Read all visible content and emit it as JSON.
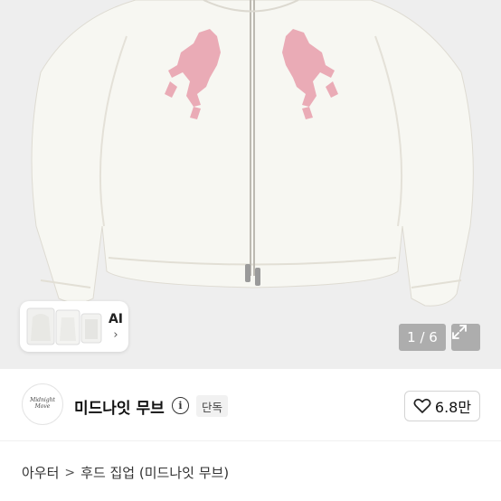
{
  "gallery": {
    "counter": "1 / 6",
    "ai_label": "AI",
    "ai_chevron": "›",
    "expand_icon": "expand-icon"
  },
  "shop": {
    "name": "미드나잇 무브",
    "logo_text": "Midnight Move",
    "info_icon": "i",
    "badge": "단독",
    "like_count": "6.8만"
  },
  "breadcrumb": {
    "items": [
      "아우터",
      "후드 집업 (미드나잇 무브)"
    ],
    "separator": ">"
  },
  "colors": {
    "image_bg": "#eeeeee",
    "jacket": "#f7f7f2",
    "horse_pink": "#e9a3b0"
  }
}
